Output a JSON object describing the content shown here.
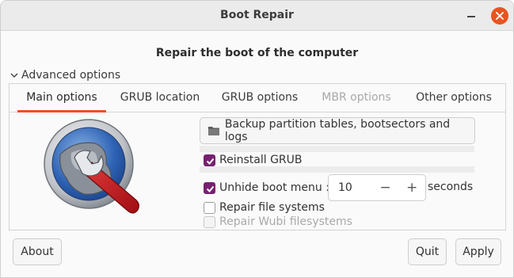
{
  "window": {
    "title": "Boot Repair"
  },
  "heading": "Repair the boot of the computer",
  "expander": {
    "label": "Advanced options",
    "expanded": true
  },
  "tabs": [
    {
      "label": "Main options",
      "active": true,
      "enabled": true
    },
    {
      "label": "GRUB location",
      "active": false,
      "enabled": true
    },
    {
      "label": "GRUB options",
      "active": false,
      "enabled": true
    },
    {
      "label": "MBR options",
      "active": false,
      "enabled": false
    },
    {
      "label": "Other options",
      "active": false,
      "enabled": true
    }
  ],
  "main": {
    "backup_button": "Backup partition tables, bootsectors and logs",
    "reinstall_grub": {
      "label": "Reinstall GRUB",
      "checked": true
    },
    "unhide_boot_menu": {
      "label": "Unhide boot menu :",
      "checked": true,
      "value": "10",
      "minus": "−",
      "plus": "+",
      "unit": "seconds"
    },
    "repair_fs": {
      "label": "Repair file systems",
      "checked": false
    },
    "repair_wubi": {
      "label": "Repair Wubi filesystems",
      "checked": false,
      "enabled": false
    }
  },
  "buttons": {
    "about": "About",
    "quit": "Quit",
    "apply": "Apply"
  },
  "colors": {
    "accent": "#e95420",
    "checkbox": "#77216f"
  },
  "icons": {
    "logo": "boot-repair-logo-icon",
    "folder": "folder-icon",
    "close": "close-icon",
    "minimize": "minimize-icon",
    "expander": "chevron-down-icon"
  }
}
